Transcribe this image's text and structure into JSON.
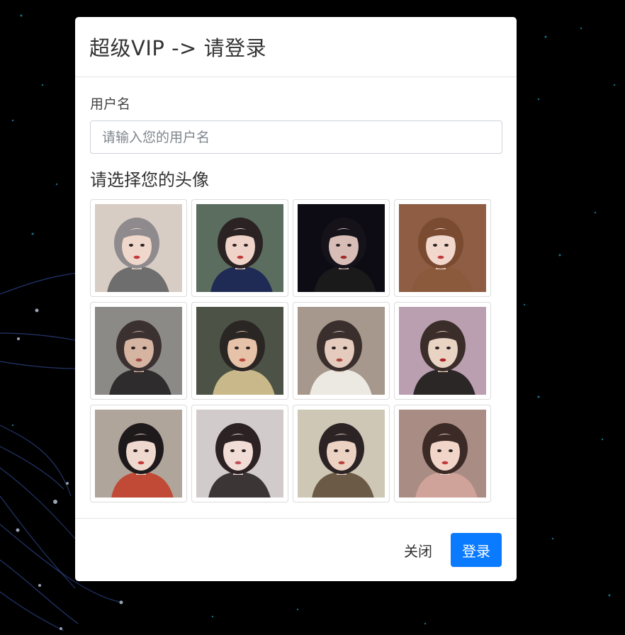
{
  "modal": {
    "title": "超级VIP -> 请登录",
    "username_label": "用户名",
    "username_placeholder": "请输入您的用户名",
    "username_value": "",
    "avatar_label": "请选择您的头像",
    "avatars": [
      {
        "icon": "avatar-photo",
        "palette": {
          "bg": "#d8cdc4",
          "hair": "#8e8a8d",
          "skin": "#efd7cb",
          "cloth": "#6e6e6e",
          "lips": "#c23a3a"
        }
      },
      {
        "icon": "avatar-photo",
        "palette": {
          "bg": "#5b6d5e",
          "hair": "#2b2224",
          "skin": "#efd3c9",
          "cloth": "#1f2a55",
          "lips": "#c23a3a"
        }
      },
      {
        "icon": "avatar-photo",
        "palette": {
          "bg": "#0d0c14",
          "hair": "#15121a",
          "skin": "#d8bdb7",
          "cloth": "#1a1a1a",
          "lips": "#a02c2c"
        }
      },
      {
        "icon": "avatar-photo",
        "palette": {
          "bg": "#8e5d44",
          "hair": "#7a4b31",
          "skin": "#f1d7cc",
          "cloth": "#8b5a3c",
          "lips": "#c23a3a"
        }
      },
      {
        "icon": "avatar-photo",
        "palette": {
          "bg": "#8c8a86",
          "hair": "#3b3131",
          "skin": "#d6b4a2",
          "cloth": "#2e2c2c",
          "lips": "#a24a44"
        }
      },
      {
        "icon": "avatar-photo",
        "palette": {
          "bg": "#4c5346",
          "hair": "#2a2623",
          "skin": "#e6c2a8",
          "cloth": "#c9b98a",
          "lips": "#b8463c"
        }
      },
      {
        "icon": "avatar-photo",
        "palette": {
          "bg": "#a6988c",
          "hair": "#3a2f2c",
          "skin": "#e4cbbd",
          "cloth": "#ece8e2",
          "lips": "#b0443e"
        }
      },
      {
        "icon": "avatar-photo",
        "palette": {
          "bg": "#b99fb0",
          "hair": "#3b2d29",
          "skin": "#e9d4c4",
          "cloth": "#2b2727",
          "lips": "#b01f25"
        }
      },
      {
        "icon": "avatar-photo",
        "palette": {
          "bg": "#b0a59a",
          "hair": "#1e1a1c",
          "skin": "#efd8cd",
          "cloth": "#c04a36",
          "lips": "#c23a3a"
        }
      },
      {
        "icon": "avatar-photo",
        "palette": {
          "bg": "#d1cccb",
          "hair": "#2c2224",
          "skin": "#f1ddd5",
          "cloth": "#3b3535",
          "lips": "#c2505a"
        }
      },
      {
        "icon": "avatar-photo",
        "palette": {
          "bg": "#cfc7b6",
          "hair": "#2c2325",
          "skin": "#ecd2c3",
          "cloth": "#6b5a45",
          "lips": "#b8433e"
        }
      },
      {
        "icon": "avatar-photo",
        "palette": {
          "bg": "#a98c84",
          "hair": "#3b2a26",
          "skin": "#f1d5c9",
          "cloth": "#cfa29a",
          "lips": "#c23a3a"
        }
      }
    ],
    "close_label": "关闭",
    "login_label": "登录"
  },
  "colors": {
    "background": "#000000",
    "primary": "#0a7bff",
    "particles": "#1fa2c4"
  }
}
